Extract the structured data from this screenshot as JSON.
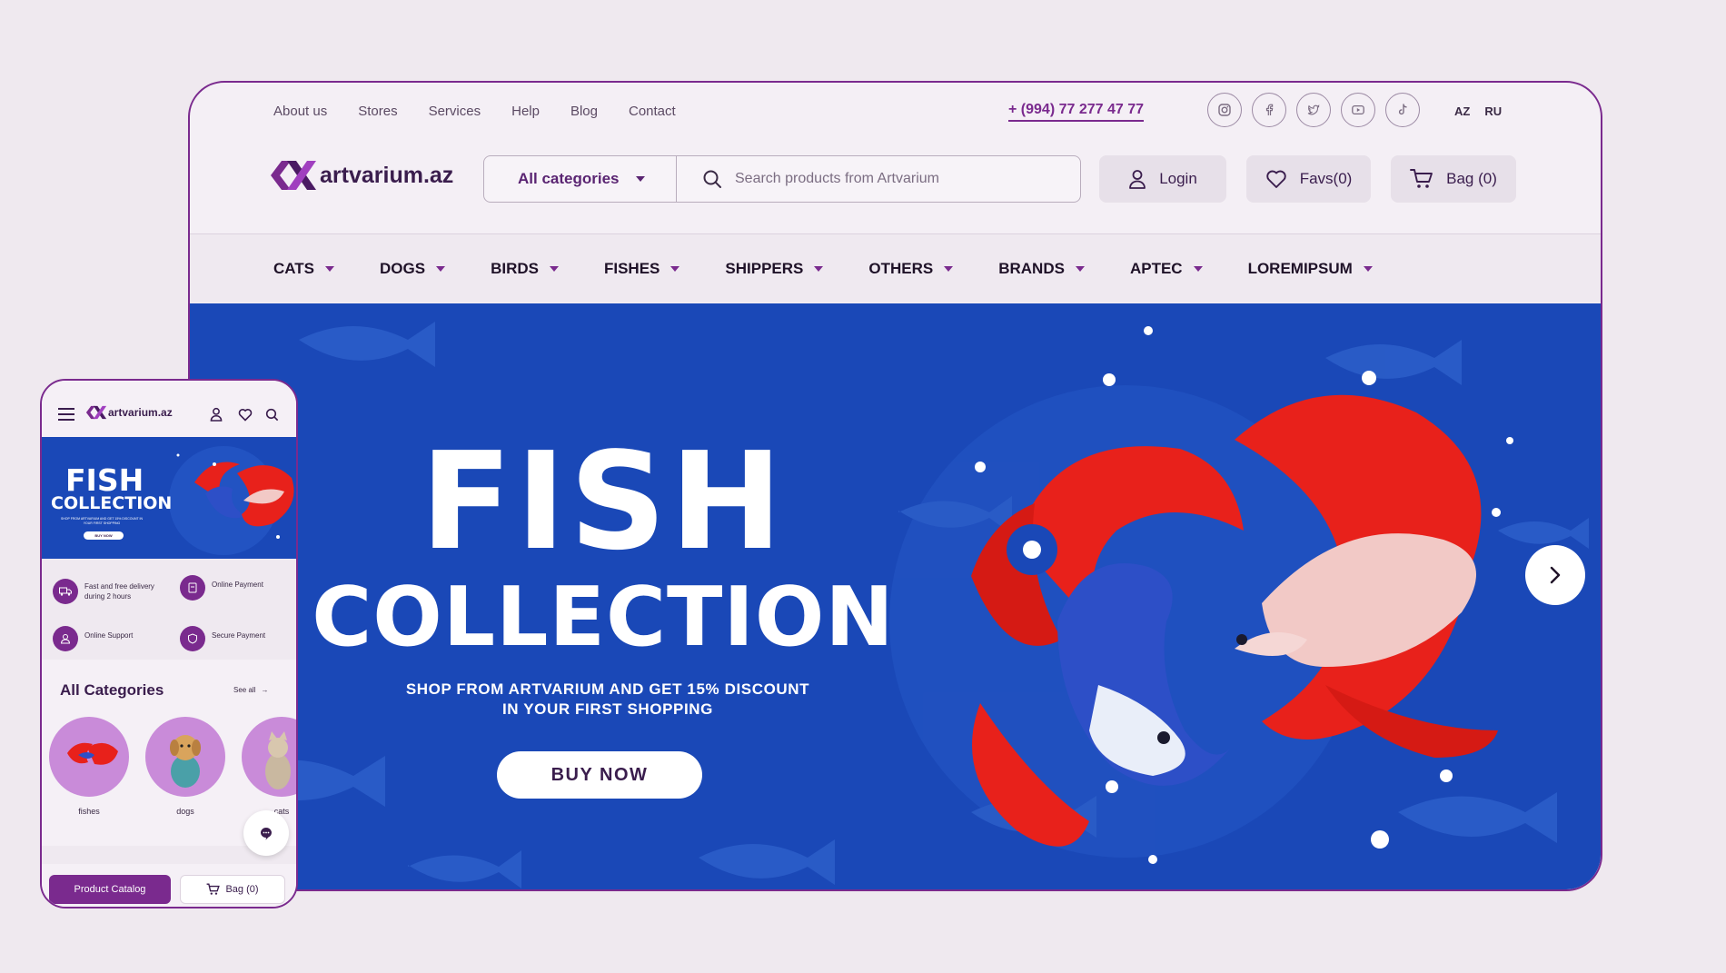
{
  "desktop": {
    "top_links": [
      "About us",
      "Stores",
      "Services",
      "Help",
      "Blog",
      "Contact"
    ],
    "phone": "+ (994) 77 277 47 77",
    "social_icons": [
      "instagram-icon",
      "facebook-icon",
      "twitter-icon",
      "youtube-icon",
      "tiktok-icon"
    ],
    "languages": [
      "AZ",
      "RU"
    ],
    "logo_text": "artvarium.az",
    "search": {
      "category_label": "All categories",
      "placeholder": "Search products from Artvarium"
    },
    "header_buttons": {
      "login": "Login",
      "favs": "Favs(0)",
      "bag": "Bag (0)"
    },
    "category_nav": [
      "CATS",
      "DOGS",
      "BIRDS",
      "FISHES",
      "SHIPPERS",
      "OTHERS",
      "BRANDS",
      "APTEC",
      "LOREMIPSUM"
    ],
    "hero": {
      "title_line1": "FISH",
      "title_line2": "COLLECTION",
      "subtitle_line1": "SHOP FROM ARTVARIUM AND GET 15% DISCOUNT",
      "subtitle_line2": "IN YOUR FIRST SHOPPING",
      "cta": "BUY NOW"
    }
  },
  "mobile": {
    "logo_text": "artvarium.az",
    "banner": {
      "title_line1": "FISH",
      "title_line2": "COLLECTION",
      "subtitle": "SHOP FROM ARTVARIUM AND GET 15% DISCOUNT IN YOUR FIRST SHOPPING",
      "cta": "BUY NOW"
    },
    "features": [
      "Fast and free delivery during 2 hours",
      "Online Payment",
      "Online Support",
      "Secure Payment"
    ],
    "section_title": "All Categories",
    "see_all": "See all",
    "categories": [
      "fishes",
      "dogs",
      "cats"
    ],
    "footer": {
      "catalog": "Product Catalog",
      "bag": "Bag (0)"
    }
  },
  "colors": {
    "brand_purple": "#7a2a8e",
    "hero_blue": "#1a48b7",
    "fish_red": "#e8211b",
    "background": "#efe9ef"
  }
}
